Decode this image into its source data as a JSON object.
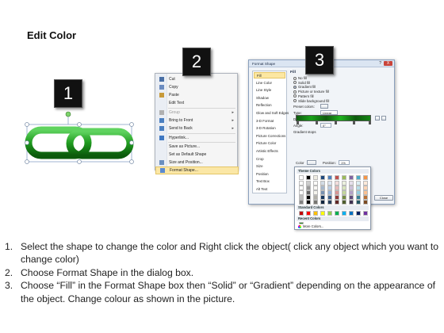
{
  "title": "Edit Color",
  "steps": [
    "1",
    "2",
    "3"
  ],
  "chain_color": "#1f9a1f",
  "context_menu": {
    "items": [
      {
        "label": "Cut",
        "icon": "scissors-icon",
        "disabled": false,
        "submenu": false
      },
      {
        "label": "Copy",
        "icon": "copy-icon",
        "disabled": false,
        "submenu": false
      },
      {
        "label": "Paste",
        "icon": "paste-icon",
        "disabled": false,
        "submenu": false
      },
      {
        "label": "Edit Text",
        "icon": "",
        "disabled": false,
        "submenu": false
      },
      {
        "label": "Group",
        "icon": "group-icon",
        "disabled": true,
        "submenu": true
      },
      {
        "label": "Bring to Front",
        "icon": "bring-front-icon",
        "disabled": false,
        "submenu": true
      },
      {
        "label": "Send to Back",
        "icon": "send-back-icon",
        "disabled": false,
        "submenu": true
      },
      {
        "label": "Hyperlink...",
        "icon": "hyperlink-icon",
        "disabled": false,
        "submenu": false
      },
      {
        "label": "Save as Picture...",
        "icon": "",
        "disabled": false,
        "submenu": false
      },
      {
        "label": "Set as Default Shape",
        "icon": "",
        "disabled": false,
        "submenu": false
      },
      {
        "label": "Size and Position...",
        "icon": "size-icon",
        "disabled": false,
        "submenu": false
      },
      {
        "label": "Format Shape...",
        "icon": "format-shape-icon",
        "disabled": false,
        "submenu": false,
        "highlighted": true
      }
    ]
  },
  "dialog": {
    "title": "Format Shape",
    "help": "?",
    "close_x": "X",
    "nav": [
      "Fill",
      "Line Color",
      "Line Style",
      "Shadow",
      "Reflection",
      "Glow and Soft Edges",
      "3-D Format",
      "3-D Rotation",
      "Picture Corrections",
      "Picture Color",
      "Artistic Effects",
      "Crop",
      "Size",
      "Position",
      "Text Box",
      "Alt Text"
    ],
    "selected_nav": "Fill",
    "fill_heading": "Fill",
    "fill_options": [
      {
        "label": "No fill",
        "checked": false
      },
      {
        "label": "Solid fill",
        "checked": false
      },
      {
        "label": "Gradient fill",
        "checked": true
      },
      {
        "label": "Picture or texture fill",
        "checked": false
      },
      {
        "label": "Pattern fill",
        "checked": false
      },
      {
        "label": "Slide background fill",
        "checked": false
      }
    ],
    "preset_label": "Preset colors:",
    "type_label": "Type:",
    "type_value": "Linear",
    "direction_label": "Direction:",
    "angle_label": "Angle:",
    "angle_value": "0°",
    "gradient_stops_label": "Gradient stops",
    "color_label": "Color",
    "position_label": "Position:",
    "position_value": "1%",
    "brightness_label": "Brightness:",
    "transparency_label": "Transparency:",
    "rotate_label": "Rotate",
    "close_button": "Close"
  },
  "palette": {
    "theme_heading": "Theme Colors",
    "standard_heading": "Standard Colors",
    "recent_heading": "Recent Colors",
    "more_colors": "More Colors...",
    "theme_top": [
      "#ffffff",
      "#000000",
      "#eeece1",
      "#1f497d",
      "#4f81bd",
      "#c0504d",
      "#9bbb59",
      "#8064a2",
      "#4bacc6",
      "#f79646"
    ],
    "standard": [
      "#c00000",
      "#ff0000",
      "#ffc000",
      "#ffff00",
      "#92d050",
      "#00b050",
      "#00b0f0",
      "#0070c0",
      "#002060",
      "#7030a0"
    ],
    "recent": [
      "#2a8a2a"
    ]
  },
  "instructions": [
    {
      "n": "1.",
      "text": "Select the shape to change the color and Right click the object( click any object which you want to change color)"
    },
    {
      "n": "2.",
      "text": "Choose Format Shape in the dialog box."
    },
    {
      "n": "3.",
      "text": "Choose “Fill” in the Format Shape box then “Solid” or “Gradient” depending on the appearance of the object. Change colour as shown in the picture."
    }
  ]
}
